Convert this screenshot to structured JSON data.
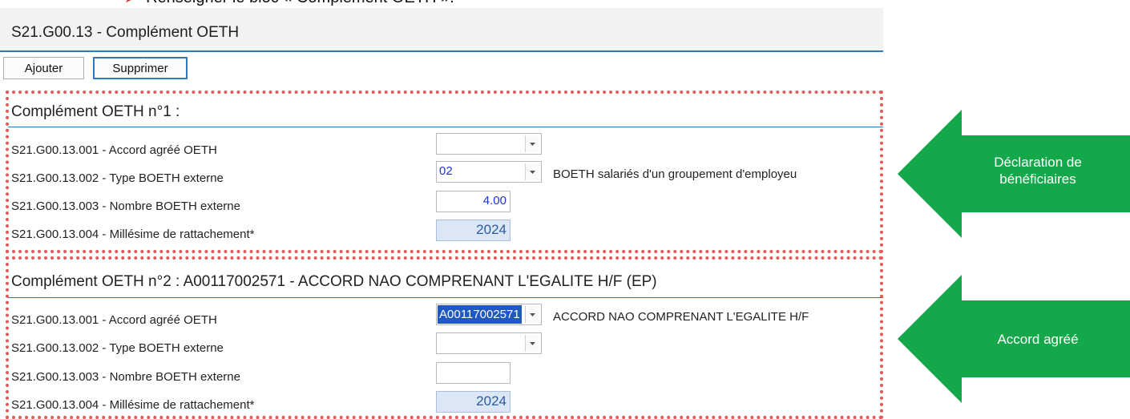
{
  "instruction": {
    "text": "Renseigner le bloc « Complément OETH »."
  },
  "window": {
    "title": "S21.G00.13 - Complément OETH"
  },
  "toolbar": {
    "add_label": "Ajouter",
    "delete_label": "Supprimer"
  },
  "sections": [
    {
      "title": "Complément OETH n°1 :",
      "rows": [
        {
          "label": "S21.G00.13.001 - Accord agréé OETH",
          "value": "",
          "description": ""
        },
        {
          "label": "S21.G00.13.002 - Type BOETH externe",
          "value": "02",
          "description": "BOETH salariés d'un groupement d'employeu"
        },
        {
          "label": "S21.G00.13.003 - Nombre BOETH externe",
          "value": "4.00"
        },
        {
          "label": "S21.G00.13.004 - Millésime de rattachement*",
          "value": "2024"
        }
      ]
    },
    {
      "title": "Complément OETH n°2 : A00117002571 - ACCORD NAO COMPRENANT L'EGALITE H/F (EP)",
      "rows": [
        {
          "label": "S21.G00.13.001 - Accord agréé OETH",
          "value": "A00117002571",
          "description": "ACCORD NAO COMPRENANT L'EGALITE H/F"
        },
        {
          "label": "S21.G00.13.002 - Type BOETH externe",
          "value": "",
          "description": ""
        },
        {
          "label": "S21.G00.13.003 - Nombre BOETH externe",
          "value": ""
        },
        {
          "label": "S21.G00.13.004 - Millésime de rattachement*",
          "value": "2024"
        }
      ]
    }
  ],
  "callouts": [
    {
      "line1": "Déclaration de",
      "line2": "bénéficiaires"
    },
    {
      "text": "Accord agréé"
    }
  ],
  "colors": {
    "accent": "#2d78c0",
    "dotted_border": "#e05a5a",
    "arrow": "#15a84a",
    "readonly_field": "#dbe7f4"
  }
}
